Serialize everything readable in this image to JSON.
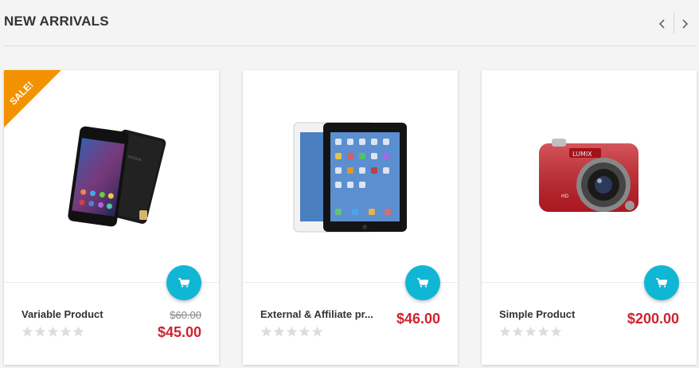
{
  "section": {
    "title": "NEW ARRIVALS"
  },
  "products": [
    {
      "badge": "SALE!",
      "name": "Variable Product",
      "old_price": "$60.00",
      "price": "$45.00",
      "image": "smartphone",
      "rating": 0
    },
    {
      "name": "External & Affiliate pr...",
      "price": "$46.00",
      "image": "tablet",
      "rating": 0
    },
    {
      "name": "Simple Product",
      "price": "$200.00",
      "image": "camera",
      "rating": 0
    }
  ],
  "icons": {
    "prev": "chevron-left-icon",
    "next": "chevron-right-icon",
    "cart": "cart-icon",
    "star": "star-icon"
  },
  "colors": {
    "accent": "#0fb7d4",
    "price": "#d0232f",
    "sale": "#f39200"
  }
}
